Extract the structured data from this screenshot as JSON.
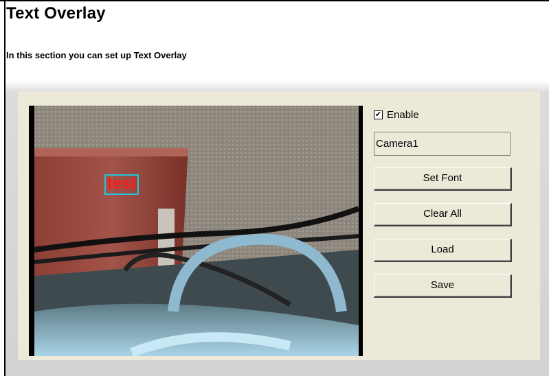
{
  "page": {
    "title": "Text Overlay",
    "subtitle": "In this section you can set up Text Overlay"
  },
  "video": {
    "overlay_text": "test"
  },
  "controls": {
    "enable_label": "Enable",
    "enable_checked": true,
    "text_value": "Camera1",
    "buttons": {
      "set_font": "Set Font",
      "clear_all": "Clear All",
      "load": "Load",
      "save": "Save"
    }
  },
  "colors": {
    "overlay_text": "#ff1a1a",
    "overlay_border": "#27c3d6",
    "panel_bg": "#ece9d8"
  }
}
